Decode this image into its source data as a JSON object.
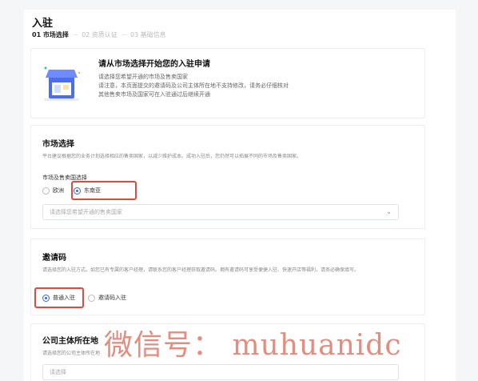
{
  "header": {
    "title": "入驻",
    "steps": [
      {
        "label": "01 市场选择"
      },
      {
        "label": "02 资质认证"
      },
      {
        "label": "03 基础信息"
      }
    ],
    "step_separator": "·····"
  },
  "banner": {
    "title": "请从市场选择开始您的入驻申请",
    "lines": [
      "请选择您希望开通的市场及售卖国家",
      "请注意，本页面提交的邀请码及公司主体所在地不支持修改，请务必仔细核对",
      "其他售卖市场及国家可在入驻通过后继续开通"
    ]
  },
  "market": {
    "title": "市场选择",
    "desc": "平台建议根据您的业务计划选择相应的售卖国家，以减少维护成本。成功入驻后，您仍然可以拓展不同的市场及售卖国家。",
    "sub_label": "市场及售卖国选择",
    "options": [
      {
        "label": "欧洲",
        "checked": false
      },
      {
        "label": "东南亚",
        "checked": true
      }
    ],
    "select_placeholder": "请选择您希望开通的售卖国家"
  },
  "invite": {
    "title": "邀请码",
    "desc": "请选择您的入驻方式。如您已有专属的客户经理，请联系您的客户经理获取邀请码。拥有邀请码可享受便捷入驻、快速开店等福利，请务必确保填写。",
    "options": [
      {
        "label": "普通入驻",
        "checked": true
      },
      {
        "label": "邀请码入驻",
        "checked": false
      }
    ]
  },
  "company": {
    "title": "公司主体所在地",
    "desc": "请选择您的公司主体所在地",
    "select_placeholder": "请选择"
  },
  "watermark": "微信号： muhuanidc",
  "colors": {
    "accent": "#3a62f0",
    "highlight": "#e04a3c",
    "watermark": "#e07868"
  }
}
